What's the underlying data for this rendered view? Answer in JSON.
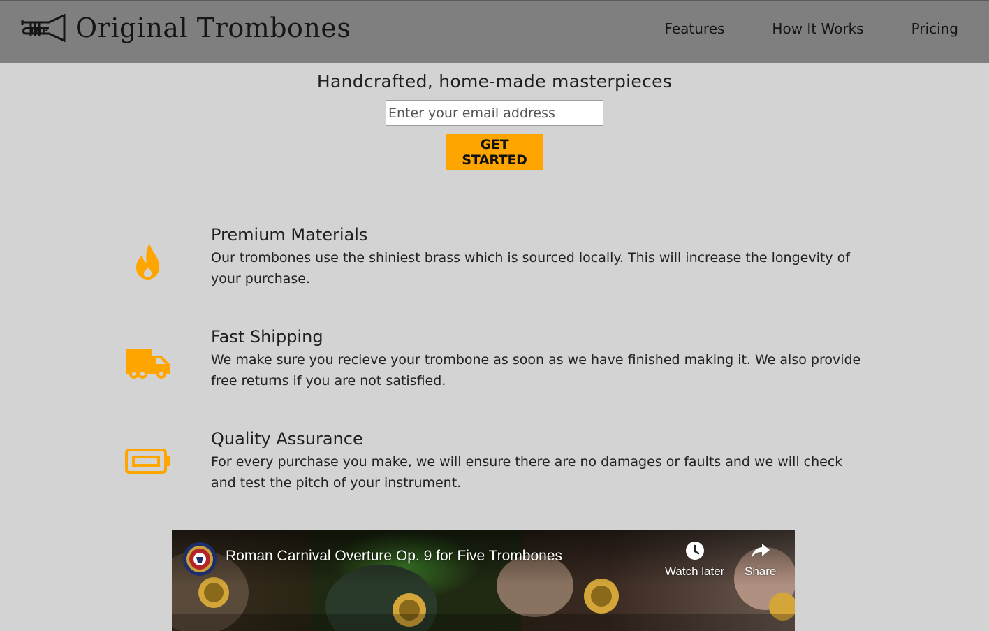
{
  "brand": {
    "name": "Original Trombones",
    "logo_icon": "trumpet-logo-icon"
  },
  "nav": {
    "links": [
      {
        "label": "Features"
      },
      {
        "label": "How It Works"
      },
      {
        "label": "Pricing"
      }
    ]
  },
  "hero": {
    "heading": "Handcrafted, home-made masterpieces",
    "email_placeholder": "Enter your email address",
    "cta_label": "GET STARTED"
  },
  "features": [
    {
      "icon": "fire-icon",
      "title": "Premium Materials",
      "description": "Our trombones use the shiniest brass which is sourced locally. This will increase the longevity of your purchase."
    },
    {
      "icon": "truck-icon",
      "title": "Fast Shipping",
      "description": "We make sure you recieve your trombone as soon as we have finished making it. We also provide free returns if you are not satisfied."
    },
    {
      "icon": "battery-icon",
      "title": "Quality Assurance",
      "description": "For every purchase you make, we will ensure there are no damages or faults and we will check and test the pitch of your instrument."
    }
  ],
  "video": {
    "title": "Roman Carnival Overture Op. 9 for Five Trombones",
    "watch_later_label": "Watch later",
    "share_label": "Share"
  },
  "colors": {
    "accent": "#ffa500",
    "navbar": "#7f7f7f",
    "background": "#d3d3d3"
  }
}
